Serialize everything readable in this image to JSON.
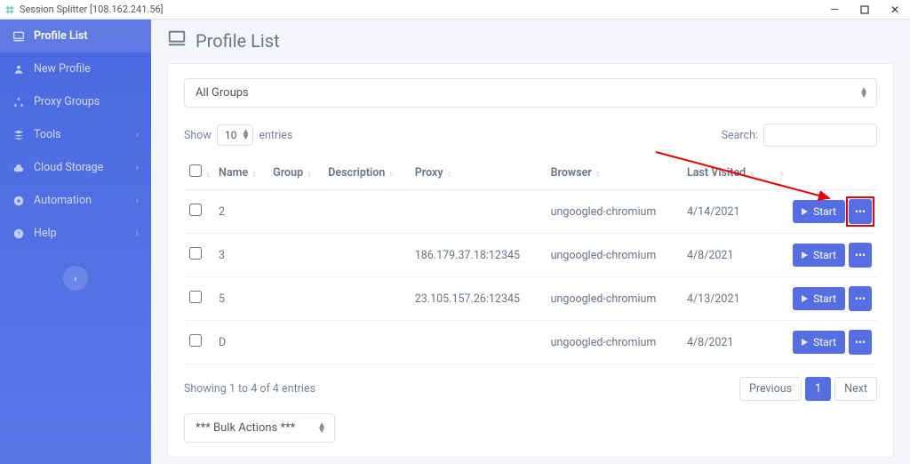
{
  "window": {
    "title": "Session Splitter [108.162.241.56]"
  },
  "sidebar": {
    "items": [
      {
        "label": "Profile List",
        "active": true,
        "expandable": false
      },
      {
        "label": "New Profile",
        "active": false,
        "expandable": false
      },
      {
        "label": "Proxy Groups",
        "active": false,
        "expandable": false
      },
      {
        "label": "Tools",
        "active": false,
        "expandable": true
      },
      {
        "label": "Cloud Storage",
        "active": false,
        "expandable": true
      },
      {
        "label": "Automation",
        "active": false,
        "expandable": true
      },
      {
        "label": "Help",
        "active": false,
        "expandable": true
      }
    ]
  },
  "page": {
    "title": "Profile List",
    "group_filter": "All Groups",
    "show_label_pre": "Show",
    "show_label_post": "entries",
    "entries_per_page": "10",
    "search_label": "Search:",
    "search_value": "",
    "info_text": "Showing 1 to 4 of 4 entries",
    "prev_label": "Previous",
    "next_label": "Next",
    "current_page": "1",
    "bulk_label": "*** Bulk Actions ***"
  },
  "table": {
    "headers": {
      "name": "Name",
      "group": "Group",
      "description": "Description",
      "proxy": "Proxy",
      "browser": "Browser",
      "last_visited": "Last Visited"
    },
    "start_label": "Start",
    "rows": [
      {
        "name": "2",
        "group": "",
        "description": "",
        "proxy": "",
        "browser": "ungoogled-chromium",
        "last_visited": "4/14/2021",
        "highlight_more": true
      },
      {
        "name": "3",
        "group": "",
        "description": "",
        "proxy": "186.179.37.18:12345",
        "browser": "ungoogled-chromium",
        "last_visited": "4/8/2021",
        "highlight_more": false
      },
      {
        "name": "5",
        "group": "",
        "description": "",
        "proxy": "23.105.157.26:12345",
        "browser": "ungoogled-chromium",
        "last_visited": "4/13/2021",
        "highlight_more": false
      },
      {
        "name": "D",
        "group": "",
        "description": "",
        "proxy": "",
        "browser": "ungoogled-chromium",
        "last_visited": "4/8/2021",
        "highlight_more": false
      }
    ]
  }
}
